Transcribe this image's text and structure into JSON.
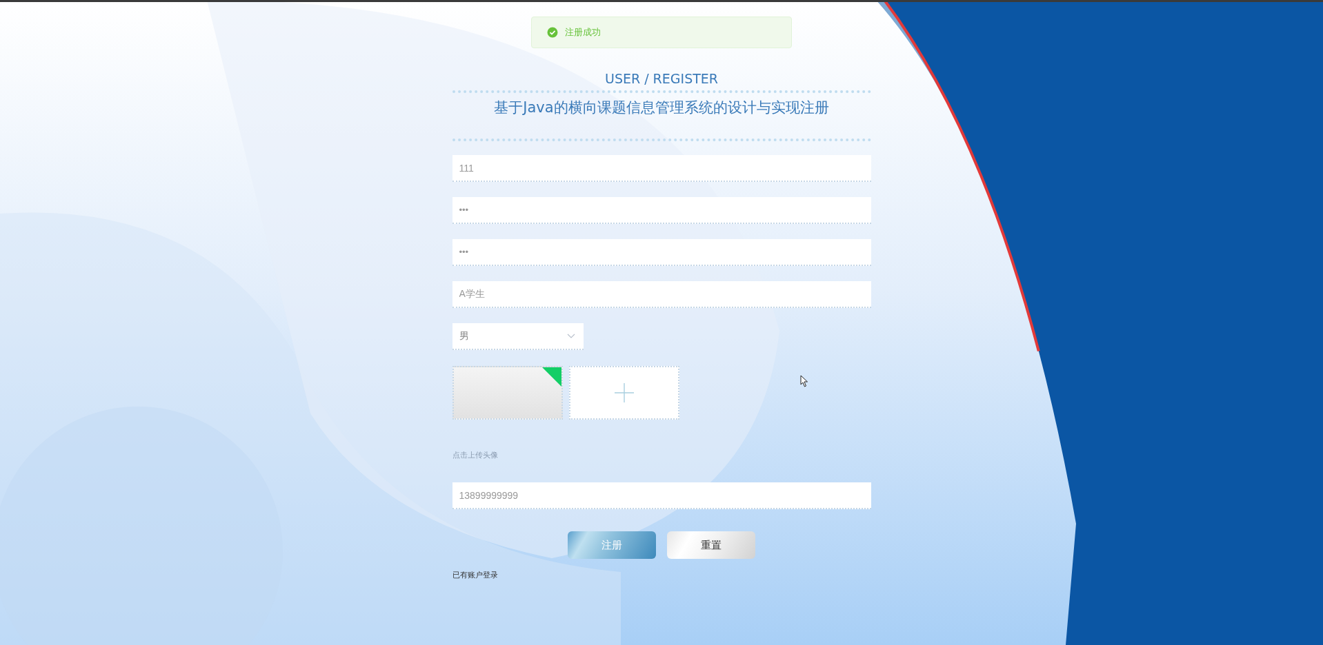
{
  "toast": {
    "kind": "success",
    "text": "注册成功"
  },
  "header": {
    "subtitle": "USER / REGISTER",
    "title": "基于Java的横向课题信息管理系统的设计与实现注册"
  },
  "fields": [
    {
      "kind": "text",
      "value": "111"
    },
    {
      "kind": "password",
      "value": "•••"
    },
    {
      "kind": "password",
      "value": "•••"
    },
    {
      "kind": "text",
      "value": "A学生"
    },
    {
      "kind": "select",
      "value": "男"
    }
  ],
  "upload": {
    "files": [
      {
        "success": true
      }
    ],
    "hint": "点击上传头像"
  },
  "phone": {
    "value": "13899999999"
  },
  "buttons": [
    {
      "kind": "primary",
      "label": "注册"
    },
    {
      "kind": "secondary",
      "label": "重置"
    }
  ],
  "login_link": "已有账户登录"
}
